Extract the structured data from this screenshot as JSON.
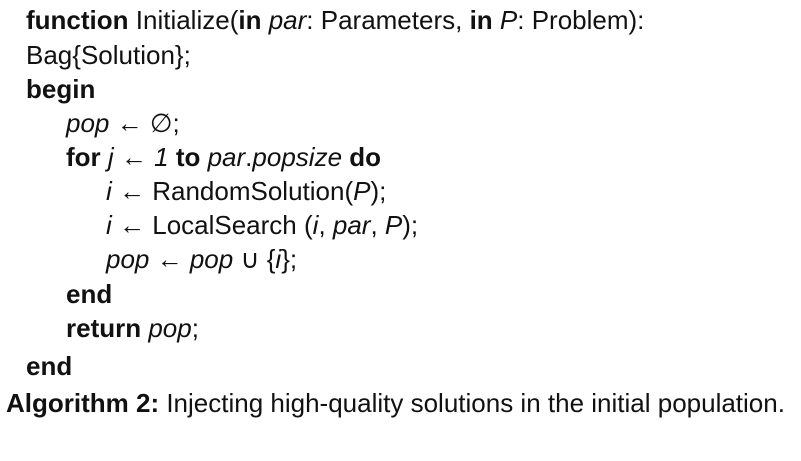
{
  "algorithm": {
    "lines": [
      {
        "parts": [
          {
            "text": "function",
            "style": "kw"
          },
          {
            "text": " Initialize(",
            "style": "normal"
          },
          {
            "text": "in",
            "style": "kw"
          },
          {
            "text": " par",
            "style": "it"
          },
          {
            "text": ": Parameters, ",
            "style": "normal"
          },
          {
            "text": "in",
            "style": "kw"
          },
          {
            "text": " P",
            "style": "it"
          },
          {
            "text": ": Problem):",
            "style": "normal"
          }
        ]
      },
      {
        "parts": [
          {
            "text": "Bag{Solution};",
            "style": "normal"
          }
        ]
      },
      {
        "parts": [
          {
            "text": "begin",
            "style": "kw"
          }
        ]
      },
      {
        "parts": [
          {
            "text": "pop",
            "style": "it"
          },
          {
            "text": " ← ∅;",
            "style": "normal"
          }
        ]
      },
      {
        "parts": [
          {
            "text": "for",
            "style": "kw"
          },
          {
            "text": " j",
            "style": "it"
          },
          {
            "text": " ← ",
            "style": "normal"
          },
          {
            "text": "1",
            "style": "it"
          },
          {
            "text": " to",
            "style": "kw"
          },
          {
            "text": " par",
            "style": "it"
          },
          {
            "text": ".",
            "style": "normal"
          },
          {
            "text": "popsize",
            "style": "it"
          },
          {
            "text": " do",
            "style": "kw"
          }
        ]
      },
      {
        "parts": [
          {
            "text": "i",
            "style": "it"
          },
          {
            "text": " ← RandomSolution(",
            "style": "normal"
          },
          {
            "text": "P",
            "style": "it"
          },
          {
            "text": ");",
            "style": "normal"
          }
        ]
      },
      {
        "parts": [
          {
            "text": "i",
            "style": "it"
          },
          {
            "text": " ← LocalSearch (",
            "style": "normal"
          },
          {
            "text": "i",
            "style": "it"
          },
          {
            "text": ", ",
            "style": "normal"
          },
          {
            "text": "par",
            "style": "it"
          },
          {
            "text": ", ",
            "style": "normal"
          },
          {
            "text": "P",
            "style": "it"
          },
          {
            "text": ");",
            "style": "normal"
          }
        ]
      },
      {
        "parts": [
          {
            "text": "pop",
            "style": "it"
          },
          {
            "text": " ← ",
            "style": "normal"
          },
          {
            "text": "pop",
            "style": "it"
          },
          {
            "text": " ∪ {",
            "style": "normal"
          },
          {
            "text": "i",
            "style": "it"
          },
          {
            "text": "};",
            "style": "normal"
          }
        ]
      },
      {
        "parts": [
          {
            "text": "end",
            "style": "kw"
          }
        ]
      },
      {
        "parts": [
          {
            "text": "return",
            "style": "kw"
          },
          {
            "text": " pop",
            "style": "it"
          },
          {
            "text": ";",
            "style": "normal"
          }
        ]
      },
      {
        "parts": [
          {
            "text": "end",
            "style": "kw"
          }
        ]
      }
    ]
  },
  "caption": {
    "label": "Algorithm 2:",
    "text": " Injecting high-quality solutions in the initial population."
  }
}
